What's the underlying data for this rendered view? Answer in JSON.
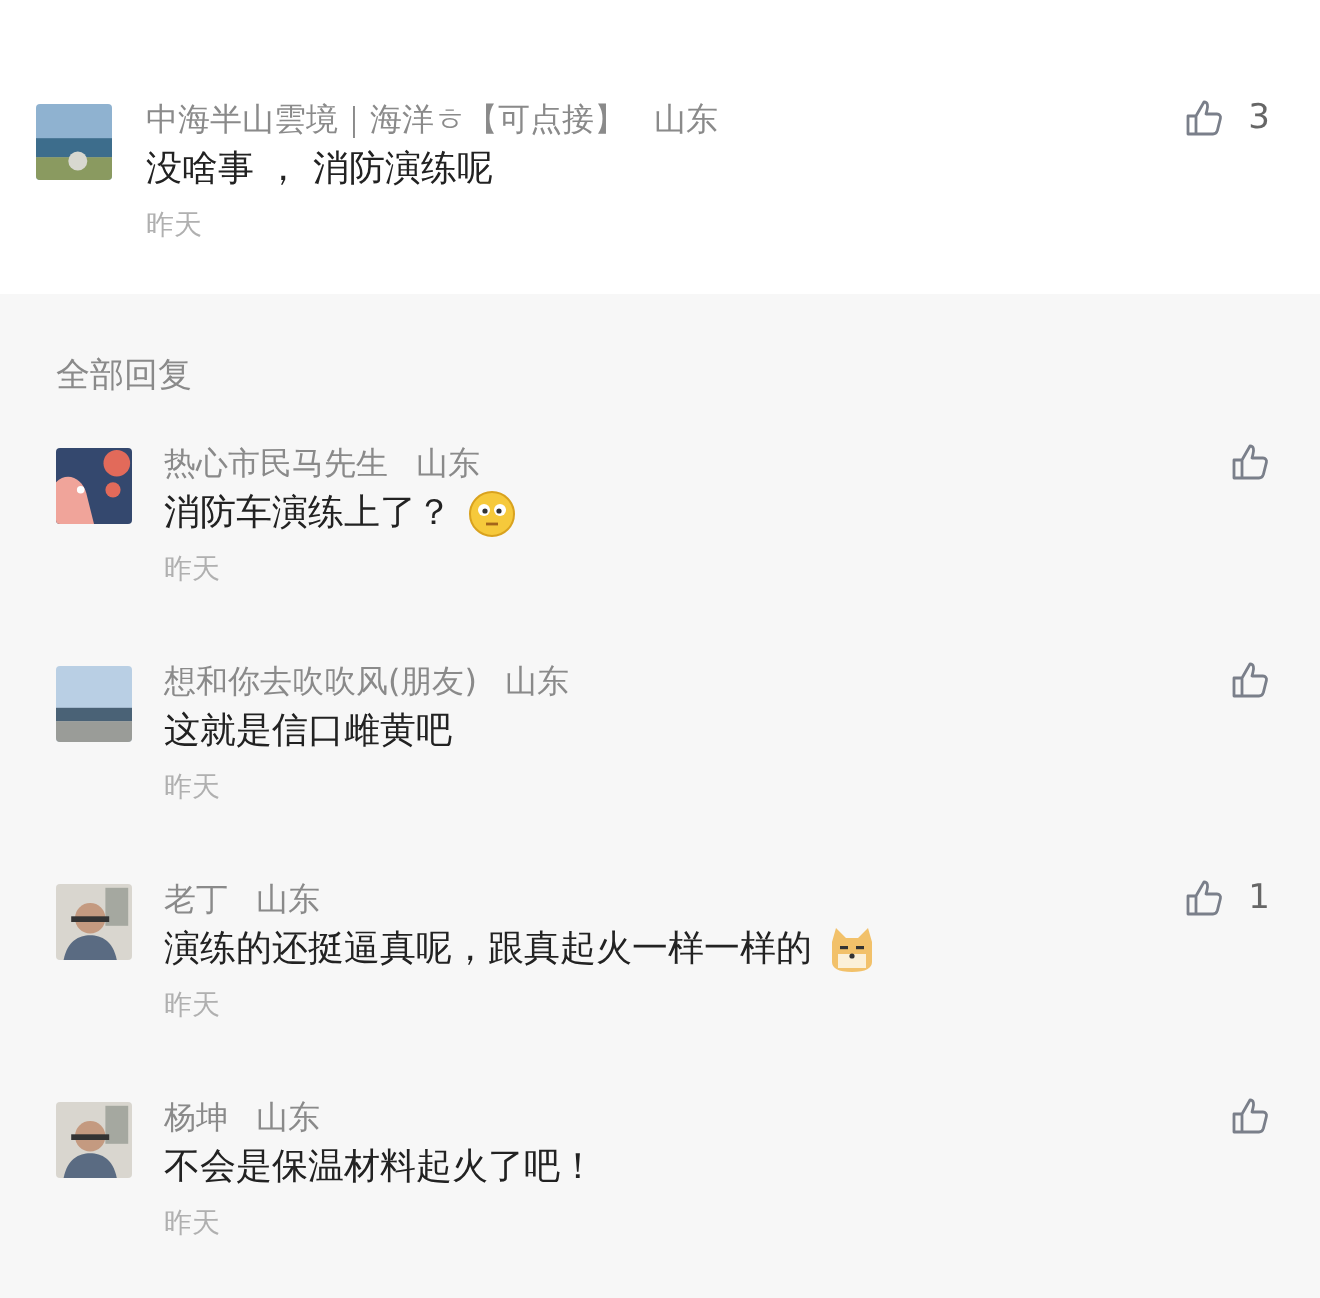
{
  "comment": {
    "author": "中海半山雲境｜海洋ㅎ【可点接】",
    "location": "山东",
    "text": "没啥事 ， 消防演练呢",
    "time": "昨天",
    "likes": "3"
  },
  "replies_header": "全部回复",
  "replies": [
    {
      "author": "热心市民马先生",
      "location": "山东",
      "text": "消防车演练上了？",
      "emoji": {
        "kind": "worried"
      },
      "time": "昨天"
    },
    {
      "author": "想和你去吹吹风(朋友)",
      "location": "山东",
      "text": "这就是信口雌黄吧",
      "time": "昨天"
    },
    {
      "author": "老丁",
      "location": "山东",
      "text": "演练的还挺逼真呢，跟真起火一样一样的",
      "emoji": {
        "kind": "cat"
      },
      "time": "昨天",
      "likes": "1"
    },
    {
      "author": "杨坤",
      "location": "山东",
      "text": "不会是保温材料起火了吧！",
      "time": "昨天"
    }
  ]
}
